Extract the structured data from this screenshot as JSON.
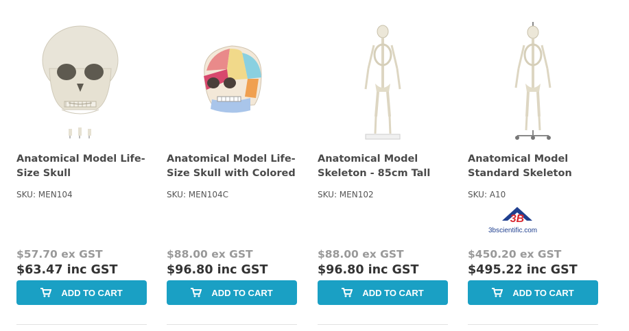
{
  "products": [
    {
      "title": "Anatomical Model Life-Size Skull",
      "sku": "SKU: MEN104",
      "price_ex": "$57.70 ex GST",
      "price_inc": "$63.47 inc GST",
      "button": "ADD TO CART",
      "image": "skull-icon"
    },
    {
      "title": "Anatomical Model Life-Size Skull with Colored",
      "sku": "SKU: MEN104C",
      "price_ex": "$88.00 ex GST",
      "price_inc": "$96.80 inc GST",
      "button": "ADD TO CART",
      "image": "colored-skull-icon"
    },
    {
      "title": "Anatomical Model Skeleton - 85cm Tall",
      "sku": "SKU: MEN102",
      "price_ex": "$88.00 ex GST",
      "price_inc": "$96.80 inc GST",
      "button": "ADD TO CART",
      "image": "skeleton-icon"
    },
    {
      "title": "Anatomical Model Standard Skeleton",
      "sku": "SKU: A10",
      "brand": "3bscientific.com",
      "brand_mark": "3B",
      "price_ex": "$450.20 ex GST",
      "price_inc": "$495.22 inc GST",
      "button": "ADD TO CART",
      "image": "skeleton-stand-icon"
    }
  ],
  "colors": {
    "button": "#1aa0c4",
    "brand_blue": "#1f3f8f",
    "brand_red": "#d9272e"
  }
}
